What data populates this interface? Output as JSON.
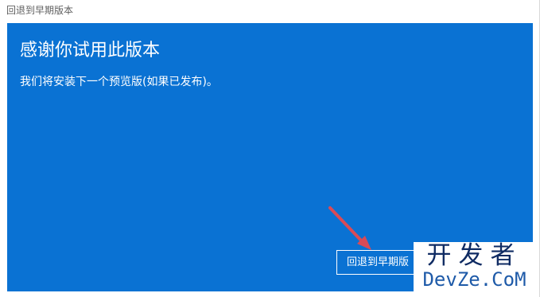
{
  "window": {
    "title": "回退到早期版本"
  },
  "main": {
    "heading": "感谢你试用此版本",
    "description": "我们将安装下一个预览版(如果已发布)。",
    "button_label": "回退到早期版",
    "accent_color": "#0a72d3"
  },
  "watermark": {
    "cn_text": "开发者",
    "en_text": "DevZe.CoM"
  },
  "icons": {
    "arrow": "arrow-icon"
  },
  "colors": {
    "arrow": "#d94b57",
    "watermark_cn": "#0f2b63",
    "watermark_en": "#1e5aa8"
  }
}
